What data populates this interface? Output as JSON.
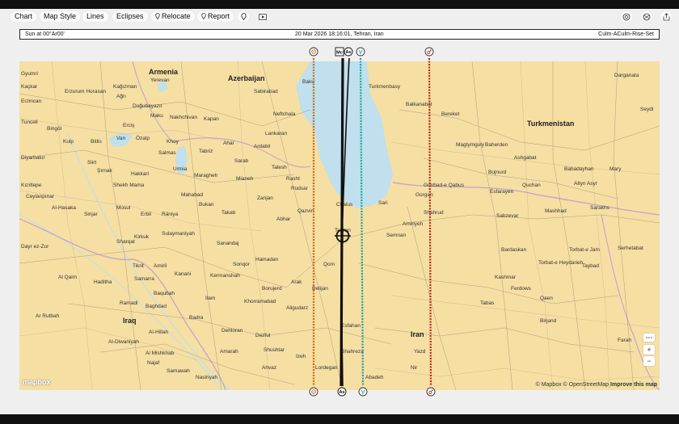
{
  "toolbar": {
    "chart": "Chart",
    "map_style": "Map Style",
    "lines": "Lines",
    "eclipses": "Eclipses",
    "relocate": "Relocate",
    "report": "Report"
  },
  "infobar": {
    "left": "Sun at 00°Ar00'",
    "center": "20 Mar 2026 18:16:01, Tehran, Iran",
    "right": "Culm-ACulm-Rise-Set"
  },
  "map": {
    "countries": [
      "Armenia",
      "Azerbaijan",
      "Turkmenistan",
      "Iraq",
      "Iran"
    ],
    "places": [
      "Gyumri",
      "Kaçkar",
      "Kağızman",
      "Yerevan",
      "Baku",
      "Erzincan",
      "Erzurum Horasan",
      "Ağrı",
      "Nakhchivan",
      "Kapan",
      "Sabirabad",
      "Doğubayazıt",
      "Maku",
      "Neftchala",
      "Tunceli",
      "Bingöl",
      "Erciş",
      "Lankaran",
      "Kulp",
      "Bitlis",
      "Van",
      "Özalp",
      "Khoy",
      "Ahar",
      "Ardabil",
      "Diyarbakır",
      "Siirt",
      "Salmas",
      "Tabriz",
      "Sarab",
      "Şırnak",
      "Hakkari",
      "Urmia",
      "Maragheh",
      "Mianeh",
      "Talesh",
      "Kızıltepe",
      "Shekh Mama",
      "Rasht",
      "Rudsar",
      "Ceylanpınar",
      "Mahabad",
      "Zanjan",
      "Qazvin",
      "Al-Hasaka",
      "Sinjar",
      "Mosul",
      "Erbil",
      "Rāniya",
      "Bukan",
      "Takab",
      "Abhar",
      "Chalus",
      "Sari",
      "Gorgan",
      "Dayr ez-Zor",
      "Kirkuk",
      "Sulaymaniyah",
      "Sanandaj",
      "Tehran",
      "Semnan",
      "Shahrud",
      "Sharqat",
      "Tikrit",
      "Amirli",
      "Hamadan",
      "Sonqor",
      "Qom",
      "Kermanshah",
      "Al Qaim",
      "Haditha",
      "Samarra",
      "Kanani",
      "Arak",
      "Delijan",
      "Baqubah",
      "Borujerd",
      "Ramadi",
      "Baghdad",
      "Ilam",
      "Khorramabad",
      "Aligudarz",
      "Al-Hillah",
      "Badra",
      "Dehloran",
      "Dezful",
      "Esfahan",
      "Ar Rutbah",
      "Al-Diwaniyah",
      "Shushtar",
      "Izeh",
      "Shahreza",
      "Amarah",
      "Al Mishkhab",
      "Ahvaz",
      "Lordegan",
      "Najaf",
      "Samawah",
      "Nasiriyah",
      "Abadeh",
      "Yazd",
      "Nir",
      "Turkmenbasy",
      "Balkanabat",
      "Bereket",
      "Darganata",
      "Seydi",
      "Magtymguly",
      "Baherden",
      "Ashgabat",
      "Babadayhan",
      "Mary",
      "Esfarayen",
      "Bojnurd",
      "Quchan",
      "Altyn Asyr",
      "Gonbad-e Qabus",
      "Amiriyeh",
      "Mashhad",
      "Sarakhs",
      "Sabzevar",
      "Torbat-e Heydarieh",
      "Bardaskan",
      "Torbat-e Jam",
      "Serhetabat",
      "Taybad",
      "Kashmar",
      "Ferdows",
      "Qaen",
      "Tabas",
      "Birjand",
      "Farah"
    ],
    "attribution_prefix": "© Mapbox © OpenStreetMap",
    "attribution_link": "Improve this map",
    "logo": "mapbox",
    "zoom_in": "+",
    "zoom_out": "−"
  },
  "lines": [
    {
      "name": "Sun culminating",
      "color": "#c96a1a"
    },
    {
      "name": "MC",
      "color": "#111111",
      "top_label": "Mc"
    },
    {
      "name": "Ascendant",
      "color": "#111111",
      "top_label": "As",
      "bottom_label": "As"
    },
    {
      "name": "Mercury",
      "color": "#1aa69e"
    },
    {
      "name": "Mars",
      "color": "#b52a1a"
    }
  ]
}
